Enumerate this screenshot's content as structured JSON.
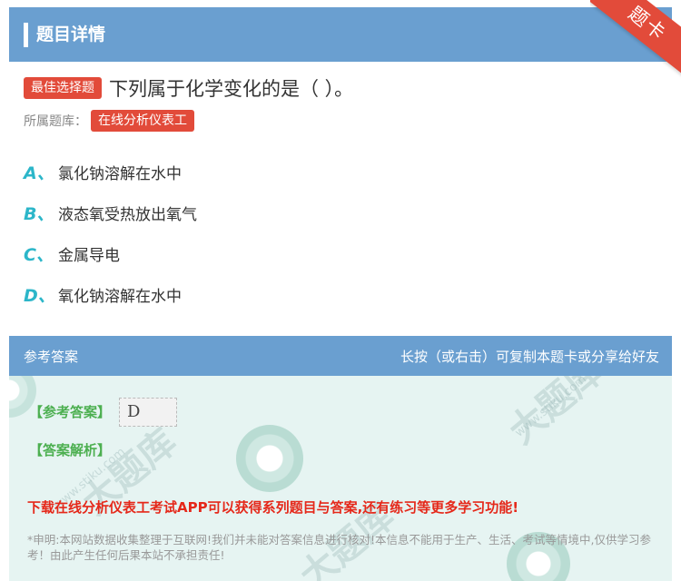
{
  "header": {
    "title": "题目详情"
  },
  "ribbon": {
    "label": "题卡"
  },
  "question": {
    "type_tag": "最佳选择题",
    "text": "下列属于化学变化的是（  ）。",
    "bank_label": "所属题库：",
    "bank_name": "在线分析仪表工"
  },
  "options": [
    {
      "letter": "A、",
      "text": "氯化钠溶解在水中"
    },
    {
      "letter": "B、",
      "text": "液态氧受热放出氧气"
    },
    {
      "letter": "C、",
      "text": "金属导电"
    },
    {
      "letter": "D、",
      "text": "氧化钠溶解在水中"
    }
  ],
  "answer_section": {
    "title": "参考答案",
    "hint": "长按（或右击）可复制本题卡或分享给好友",
    "answer_label": "【参考答案】",
    "answer_value": "D",
    "analysis_label": "【答案解析】",
    "promo": "下载在线分析仪表工考试APP可以获得系列题目与答案,还有练习等更多学习功能!",
    "disclaimer": "*申明:本网站数据收集整理于互联网!我们并未能对答案信息进行核对!本信息不能用于生产、生活、考试等情境中,仅供学习参考！由此产生任何后果本站不承担责任!"
  },
  "colors": {
    "header_blue": "#6a9fd0",
    "tag_red": "#e24b3a",
    "option_letter": "#2cb6c9",
    "answer_green": "#4caf50",
    "promo_red": "#e5281a",
    "panel_bg": "#e6f4f2"
  }
}
